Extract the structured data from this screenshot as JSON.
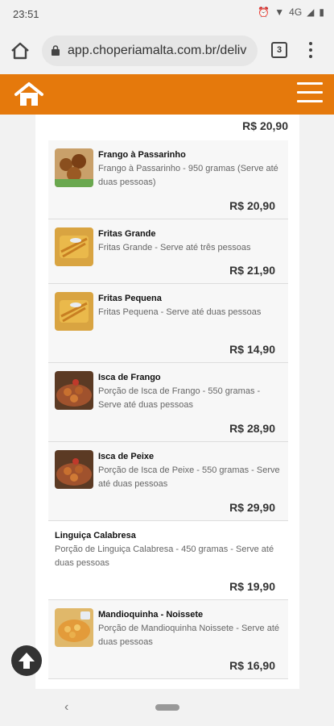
{
  "status_bar": {
    "time": "23:51",
    "network": "4G"
  },
  "browser": {
    "url": "app.choperiamalta.com.br/deliv",
    "tab_count": "3"
  },
  "colors": {
    "brand": "#e5790c"
  },
  "menu": {
    "first_price": "R$ 20,90",
    "items": [
      {
        "title": "Frango à Passarinho",
        "description": "Frango à Passarinho - 950 gramas (Serve até duas pessoas)",
        "price": "R$ 20,90"
      },
      {
        "title": "Fritas Grande",
        "description": "Fritas Grande - Serve até três pessoas",
        "price": "R$ 21,90"
      },
      {
        "title": "Fritas Pequena",
        "description": "Fritas Pequena - Serve até duas pessoas",
        "price": "R$ 14,90"
      },
      {
        "title": "Isca de Frango",
        "description": "Porção de Isca de Frango - 550 gramas - Serve até duas pessoas",
        "price": "R$ 28,90"
      },
      {
        "title": "Isca de Peixe",
        "description": "Porção de Isca de Peixe - 550 gramas - Serve até duas pessoas",
        "price": "R$ 29,90"
      },
      {
        "title": "Linguiça Calabresa",
        "description": "Porção de Linguiça Calabresa - 450 gramas - Serve até duas pessoas",
        "price": "R$ 19,90"
      },
      {
        "title": "Mandioquinha - Noissete",
        "description": "Porção de Mandioquinha Noissete - Serve até duas pessoas",
        "price": "R$ 16,90"
      }
    ]
  }
}
